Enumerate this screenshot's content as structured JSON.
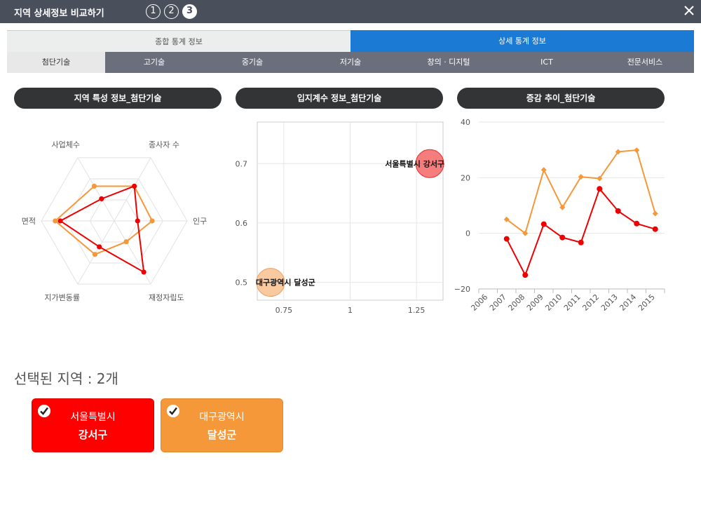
{
  "window": {
    "title": "지역 상세정보 비교하기",
    "steps": [
      "1",
      "2",
      "3"
    ],
    "active_step": 3
  },
  "top_tabs": [
    {
      "label": "종합 통계 정보",
      "active": false
    },
    {
      "label": "상세 통계 정보",
      "active": true
    }
  ],
  "sub_tabs": [
    {
      "label": "첨단기술",
      "active": true
    },
    {
      "label": "고기술",
      "active": false
    },
    {
      "label": "중기술",
      "active": false
    },
    {
      "label": "저기술",
      "active": false
    },
    {
      "label": "창의 · 디지털",
      "active": false
    },
    {
      "label": "ICT",
      "active": false
    },
    {
      "label": "전문서비스",
      "active": false
    }
  ],
  "panels": {
    "radar_title": "지역 특성 정보_첨단기술",
    "bubble_title": "입지계수 정보_첨단기술",
    "trend_title": "증감 추이_첨단기술"
  },
  "colors": {
    "seoul": "#ee0000",
    "daegu": "#f49839",
    "header": "#4a4f5c",
    "tab_active": "#1a7ad4"
  },
  "chart_data": [
    {
      "type": "radar",
      "axes": [
        "종사자 수",
        "인구",
        "재정자립도",
        "지가변동률",
        "면적",
        "사업체수"
      ],
      "levels": 3,
      "series": [
        {
          "name": "서울특별시 강서구",
          "values": [
            0.55,
            0.32,
            0.81,
            0.41,
            0.74,
            0.35
          ]
        },
        {
          "name": "대구광역시 달성군",
          "values": [
            0.55,
            0.52,
            0.33,
            0.53,
            0.81,
            0.55
          ]
        }
      ]
    },
    {
      "type": "scatter",
      "xlim": [
        0.65,
        1.35
      ],
      "ylim": [
        0.47,
        0.77
      ],
      "xticks": [
        "0.75",
        "1",
        "1.25"
      ],
      "yticks": [
        "0.5",
        "0.6",
        "0.7"
      ],
      "points": [
        {
          "label": "서울특별시 강서구",
          "x": 1.3,
          "y": 0.7
        },
        {
          "label": "대구광역시 달성군",
          "x": 0.7,
          "y": 0.5
        }
      ]
    },
    {
      "type": "line",
      "x": [
        "2006",
        "2007",
        "2008",
        "2009",
        "2010",
        "2011",
        "2012",
        "2013",
        "2014",
        "2015"
      ],
      "ylim": [
        -20,
        40
      ],
      "yticks": [
        "40",
        "20",
        "0",
        "−20"
      ],
      "series": [
        {
          "name": "서울특별시 강서구",
          "values": [
            null,
            -2,
            -15,
            3.3,
            -1.5,
            -3.3,
            16,
            8,
            3.5,
            1.5
          ]
        },
        {
          "name": "대구광역시 달성군",
          "values": [
            null,
            5,
            0,
            22.8,
            9.3,
            20.3,
            19.7,
            29.3,
            29.9,
            7.1
          ]
        }
      ]
    }
  ],
  "selected": {
    "label": "선택된 지역 : 2개",
    "regions": [
      {
        "line1": "서울특별시",
        "line2": "강서구"
      },
      {
        "line1": "대구광역시",
        "line2": "달성군"
      }
    ]
  }
}
